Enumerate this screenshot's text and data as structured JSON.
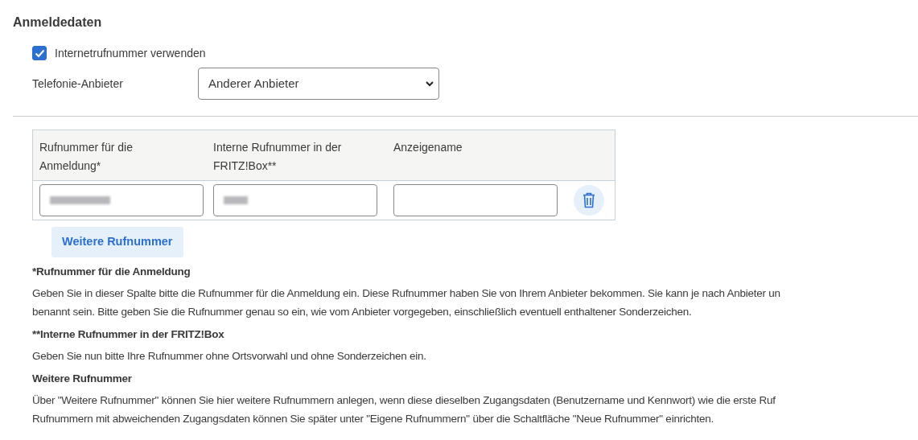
{
  "section_title": "Anmeldedaten",
  "use_internet_number": {
    "label": "Internetrufnummer verwenden",
    "checked": true
  },
  "provider": {
    "label": "Telefonie-Anbieter",
    "value": "Anderer Anbieter"
  },
  "numbers_table": {
    "columns": [
      {
        "lines": [
          "Rufnummer für die",
          "Anmeldung*"
        ]
      },
      {
        "lines": [
          "Interne Rufnummer in der",
          "FRITZ!Box**"
        ]
      },
      {
        "lines": [
          "Anzeigename"
        ]
      }
    ],
    "rows": [
      {
        "fields": [
          {
            "redacted": true
          },
          {
            "redacted": true
          },
          {
            "redacted": false
          }
        ]
      }
    ]
  },
  "add_button": "Weitere Rufnummer",
  "notes": [
    {
      "title": "*Rufnummer für die Anmeldung",
      "lines": [
        "Geben Sie in dieser Spalte bitte die Rufnummer für die Anmeldung ein. Diese Rufnummer haben Sie von Ihrem Anbieter bekommen. Sie kann je nach Anbieter un",
        "benannt sein. Bitte geben Sie die Rufnummer genau so ein, wie vom Anbieter vorgegeben, einschließlich eventuell enthaltener Sonderzeichen."
      ]
    },
    {
      "title": "**Interne Rufnummer in der FRITZ!Box",
      "lines": [
        "Geben Sie nun bitte Ihre Rufnummer ohne Ortsvorwahl und ohne Sonderzeichen ein."
      ]
    },
    {
      "title": "Weitere Rufnummer",
      "lines": [
        "Über \"Weitere Rufnummer\" können Sie hier weitere Rufnummern anlegen, wenn diese dieselben Zugangsdaten (Benutzername und Kennwort) wie die erste Ruf",
        "Rufnummern mit abweichenden Zugangsdaten können Sie später unter \"Eigene Rufnummern\" über die Schaltfläche \"Neue Rufnummer\" einrichten."
      ]
    }
  ]
}
